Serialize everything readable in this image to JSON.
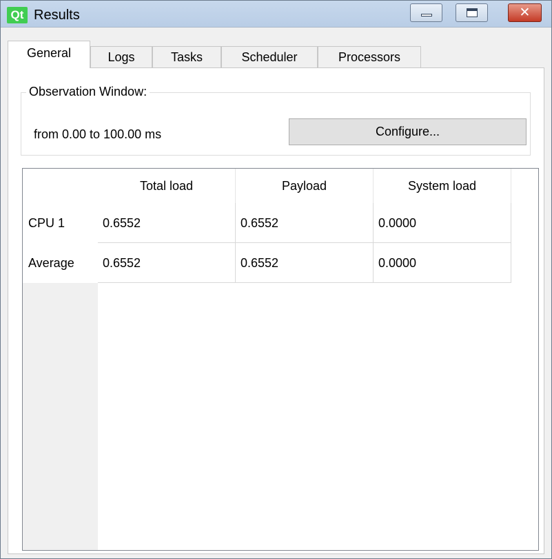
{
  "window": {
    "logo_text": "Qt",
    "title": "Results",
    "close_glyph": "✕"
  },
  "tabs": [
    {
      "label": "General",
      "active": true
    },
    {
      "label": "Logs",
      "active": false
    },
    {
      "label": "Tasks",
      "active": false
    },
    {
      "label": "Scheduler",
      "active": false
    },
    {
      "label": "Processors",
      "active": false
    }
  ],
  "observation": {
    "group_title": "Observation Window:",
    "range_text": "from 0.00 to 100.00 ms",
    "configure_label": "Configure..."
  },
  "table": {
    "columns": [
      "Total load",
      "Payload",
      "System load"
    ],
    "rows": [
      {
        "label": "CPU 1",
        "values": [
          "0.6552",
          "0.6552",
          "0.0000"
        ]
      },
      {
        "label": "Average",
        "values": [
          "0.6552",
          "0.6552",
          "0.0000"
        ]
      }
    ]
  }
}
